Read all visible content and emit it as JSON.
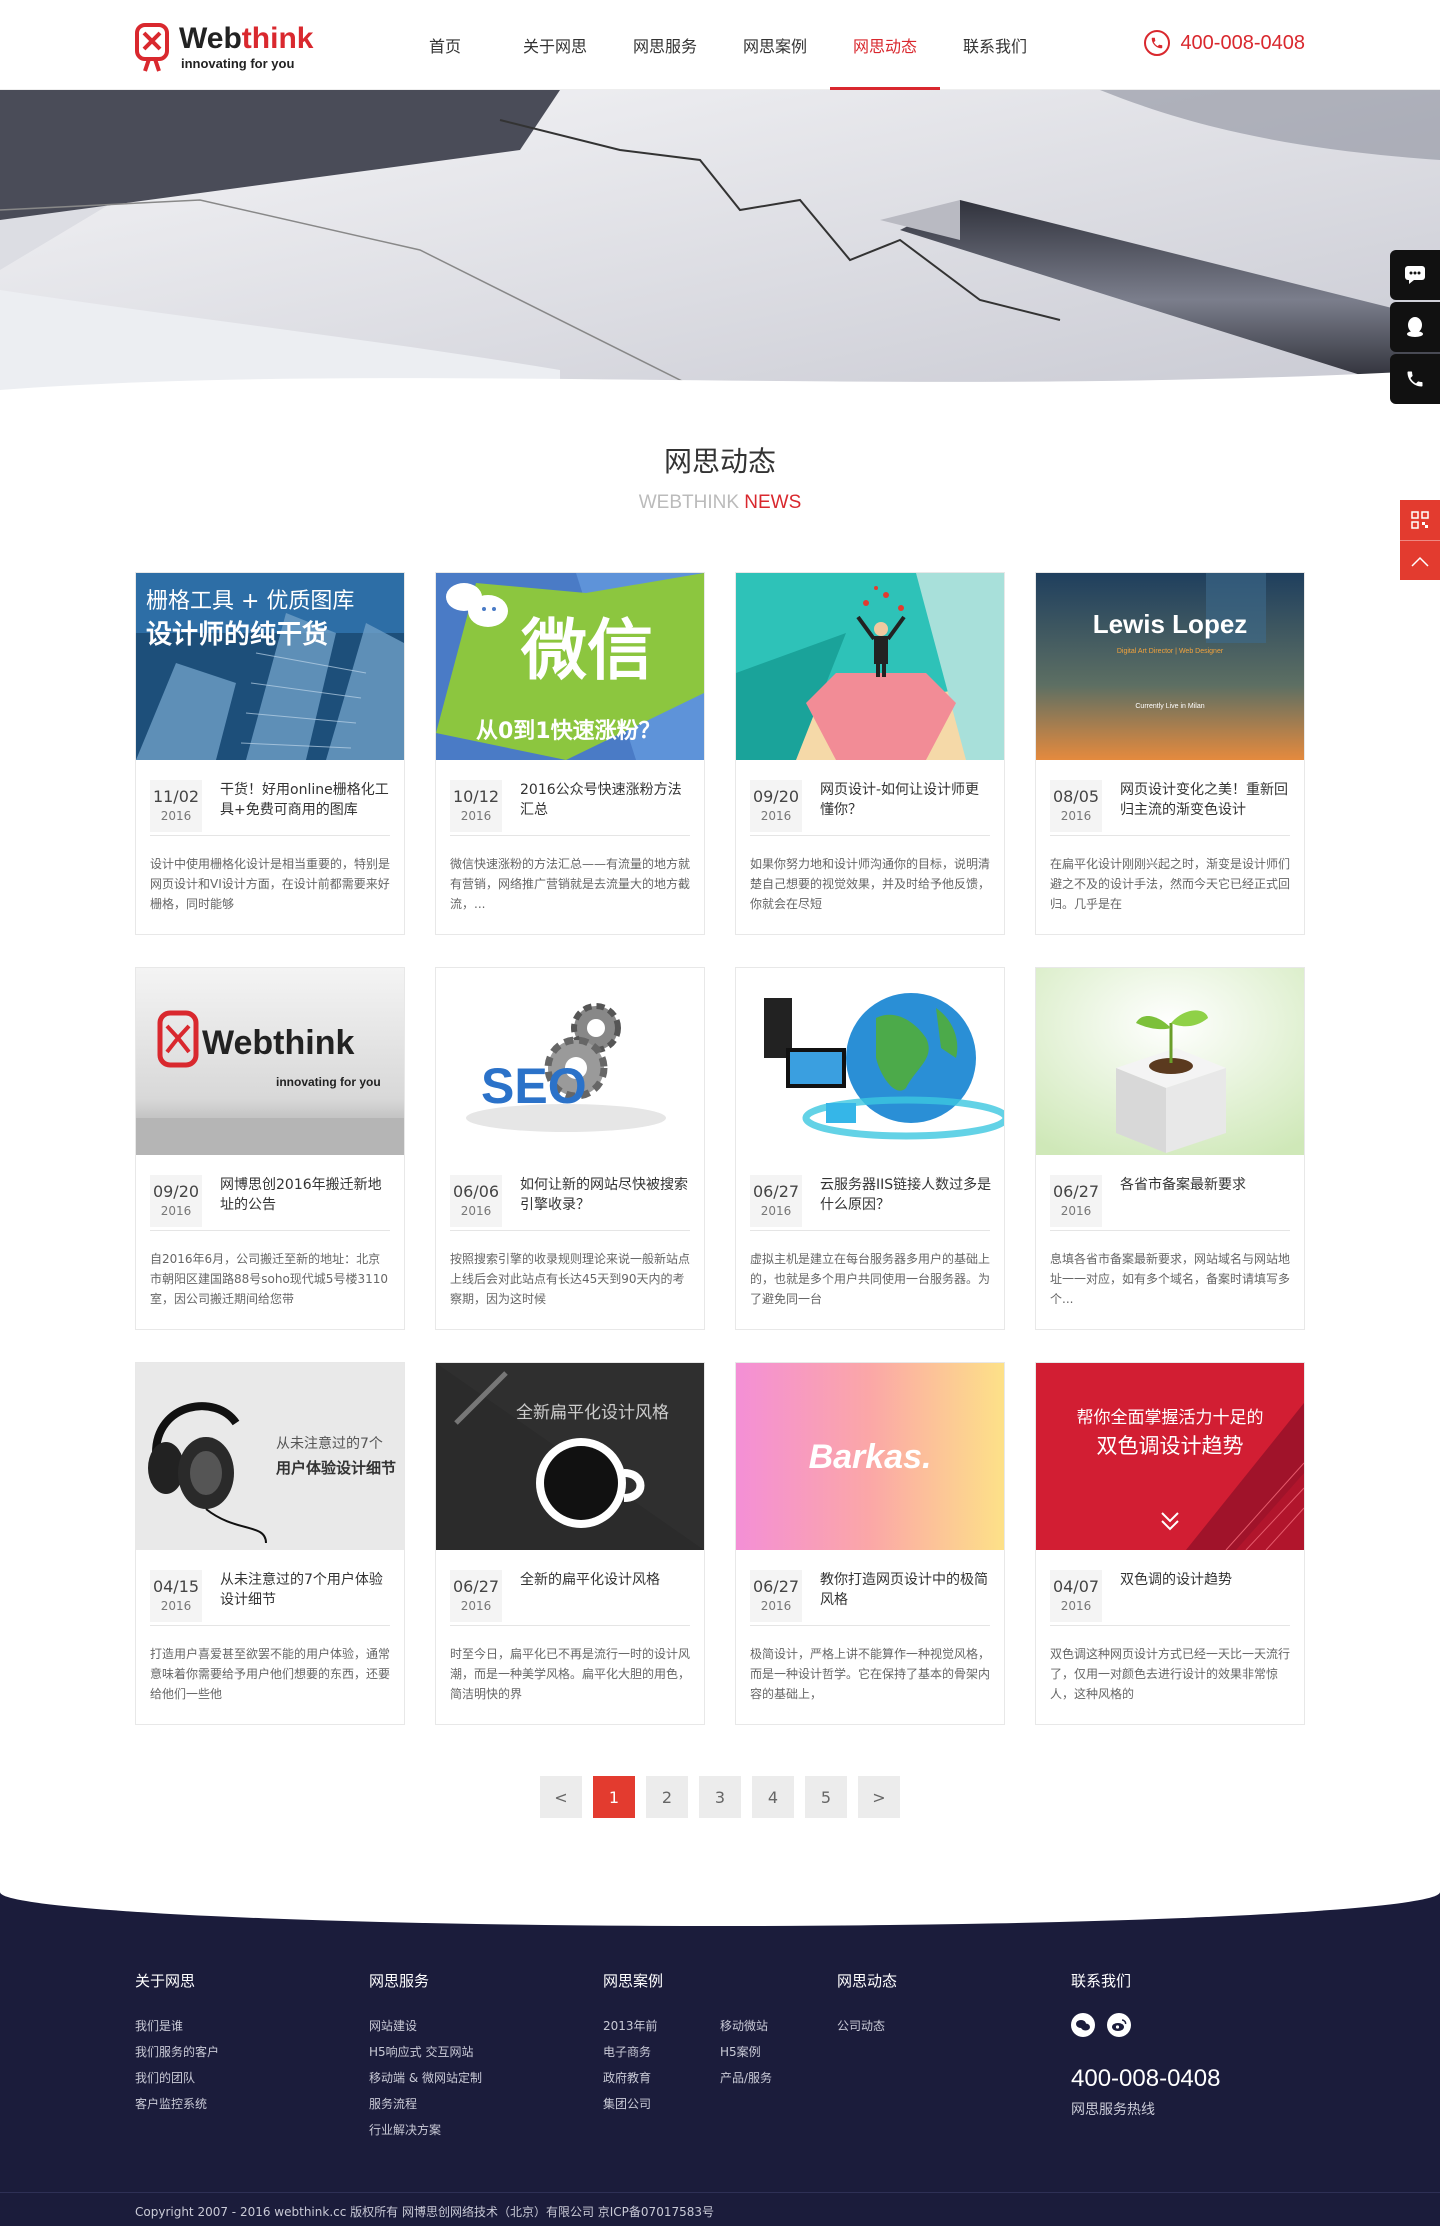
{
  "brand": {
    "name_black": "Web",
    "name_red": "think",
    "slogan": "innovating for you"
  },
  "nav": [
    {
      "label": "首页",
      "active": false
    },
    {
      "label": "关于网思",
      "active": false
    },
    {
      "label": "网思服务",
      "active": false
    },
    {
      "label": "网思案例",
      "active": false
    },
    {
      "label": "网思动态",
      "active": true
    },
    {
      "label": "联系我们",
      "active": false
    }
  ],
  "hotline": "400-008-0408",
  "section": {
    "title": "网思动态",
    "sub_grey": "WEBTHINK",
    "sub_red": "NEWS"
  },
  "cards": [
    {
      "md": "11/02",
      "year": "2016",
      "title": "干货！好用online栅格化工具+免费可商用的图库",
      "desc": "设计中使用栅格化设计是相当重要的，特别是网页设计和VI设计方面，在设计前都需要来好栅格，同时能够",
      "img_text": [
        "栅格工具 + 优质图库",
        "设计师的纯干货"
      ]
    },
    {
      "md": "10/12",
      "year": "2016",
      "title": "2016公众号快速涨粉方法汇总",
      "desc": "微信快速涨粉的方法汇总——有流量的地方就有营销，网络推广营销就是去流量大的地方截流，...",
      "img_text": [
        "微信",
        "从0到1快速涨粉？"
      ]
    },
    {
      "md": "09/20",
      "year": "2016",
      "title": "网页设计-如何让设计师更懂你？",
      "desc": "如果你努力地和设计师沟通你的目标，说明清楚自己想要的视觉效果，并及时给予他反馈，你就会在尽短",
      "img_text": []
    },
    {
      "md": "08/05",
      "year": "2016",
      "title": "网页设计变化之美！重新回归主流的渐变色设计",
      "desc": "在扁平化设计刚刚兴起之时，渐变是设计师们避之不及的设计手法，然而今天它已经正式回归。几乎是在",
      "img_text": [
        "Lewis Lopez",
        "Digital Art Director | Web Designer",
        "Currently Live in Milan"
      ]
    },
    {
      "md": "09/20",
      "year": "2016",
      "title": "网博思创2016年搬迁新地址的公告",
      "desc": "自2016年6月，公司搬迁至新的地址：北京市朝阳区建国路88号soho现代城5号楼3110室，因公司搬迁期间给您带",
      "img_text": [
        "Webthink",
        "innovating for you"
      ]
    },
    {
      "md": "06/06",
      "year": "2016",
      "title": "如何让新的网站尽快被搜索引擎收录？",
      "desc": "按照搜索引擎的收录规则理论来说一般新站点上线后会对此站点有长达45天到90天内的考察期，因为这时候",
      "img_text": [
        "SEO"
      ]
    },
    {
      "md": "06/27",
      "year": "2016",
      "title": "云服务器IIS链接人数过多是什么原因？",
      "desc": "虚拟主机是建立在每台服务器多用户的基础上的，也就是多个用户共同使用一台服务器。为了避免同一台",
      "img_text": []
    },
    {
      "md": "06/27",
      "year": "2016",
      "title": "各省市备案最新要求",
      "desc": "息填各省市备案最新要求，网站域名与网站地址一一对应，如有多个域名，备案时请填写多个...",
      "img_text": []
    },
    {
      "md": "04/15",
      "year": "2016",
      "title": "从未注意过的7个用户体验设计细节",
      "desc": "打造用户喜爱甚至欲罢不能的用户体验，通常意味着你需要给予用户他们想要的东西，还要给他们一些他",
      "img_text": [
        "从未注意过的7个",
        "用户体验设计细节"
      ]
    },
    {
      "md": "06/27",
      "year": "2016",
      "title": "全新的扁平化设计风格",
      "desc": "时至今日，扁平化已不再是流行一时的设计风潮，而是一种美学风格。扁平化大胆的用色，简洁明快的界",
      "img_text": [
        "全新扁平化设计风格"
      ]
    },
    {
      "md": "06/27",
      "year": "2016",
      "title": "教你打造网页设计中的极简风格",
      "desc": "极简设计，严格上讲不能算作一种视觉风格，而是一种设计哲学。它在保持了基本的骨架内容的基础上，",
      "img_text": [
        "Barkas."
      ]
    },
    {
      "md": "04/07",
      "year": "2016",
      "title": "双色调的设计趋势",
      "desc": "双色调这种网页设计方式已经一天比一天流行了，仅用一对颜色去进行设计的效果非常惊人，这种风格的",
      "img_text": [
        "帮你全面掌握活力十足的",
        "双色调设计趋势"
      ]
    }
  ],
  "pagination": {
    "prev": "<",
    "pages": [
      "1",
      "2",
      "3",
      "4",
      "5"
    ],
    "current": "1",
    "next": ">"
  },
  "footer": {
    "cols": [
      {
        "title": "关于网思",
        "items": [
          "我们是谁",
          "我们服务的客户",
          "我们的团队",
          "客户监控系统"
        ]
      },
      {
        "title": "网思服务",
        "items": [
          "网站建设",
          "H5响应式 交互网站",
          "移动端 & 微网站定制",
          "服务流程",
          "行业解决方案"
        ]
      },
      {
        "title": "网思案例",
        "items": [
          "2013年前",
          "移动微站",
          "电子商务",
          "H5案例",
          "政府教育",
          "产品/服务",
          "集团公司"
        ]
      },
      {
        "title": "网思动态",
        "items": [
          "公司动态"
        ]
      },
      {
        "title": "联系我们",
        "items": []
      }
    ],
    "phone": "400-008-0408",
    "phone_label": "网思服务热线",
    "copyright": "Copyright 2007 - 2016 webthink.cc   版权所有 网博思创网络技术（北京）有限公司   京ICP备07017583号"
  },
  "colors": {
    "accent": "#d9282e",
    "footer_bg": "#1b1c3b",
    "side_bar": "#111111",
    "side_red": "#e33b2f"
  },
  "icons": [
    "phone-icon",
    "chat-icon",
    "qq-icon",
    "qr-code-icon",
    "arrow-up-icon",
    "wechat-icon",
    "weibo-icon"
  ]
}
